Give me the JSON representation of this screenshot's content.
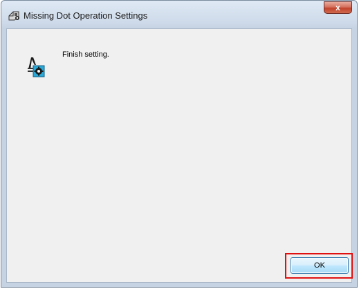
{
  "window": {
    "title": "Missing Dot Operation Settings",
    "title_icon": "printer-settings-icon",
    "close_label": "x"
  },
  "dialog": {
    "message": "Finish setting.",
    "message_icon": "printhead-gear-icon",
    "ok_label": "OK"
  },
  "colors": {
    "highlight": "#e01010",
    "close_button": "#c2422c",
    "client_background": "#f0f0f0"
  }
}
